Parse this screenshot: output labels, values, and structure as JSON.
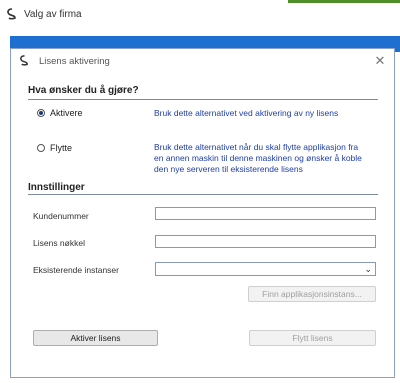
{
  "outer_window": {
    "title": "Valg av firma"
  },
  "dialog": {
    "title": "Lisens aktivering",
    "close_glyph": "✕",
    "question_heading": "Hva ønsker du å gjøre?",
    "options": [
      {
        "label": "Aktivere",
        "selected": true,
        "description": "Bruk dette alternativet ved aktivering av ny lisens"
      },
      {
        "label": "Flytte",
        "selected": false,
        "description_lines": [
          "Bruk dette alternativet når du skal flytte applikasjon fra",
          "en annen maskin til denne maskinen og ønsker å koble",
          "den nye serveren til eksisterende lisens"
        ]
      }
    ],
    "settings_heading": "Innstillinger",
    "fields": {
      "customer_number": {
        "label": "Kundenummer",
        "value": ""
      },
      "license_key": {
        "label": "Lisens nøkkel",
        "value": ""
      },
      "existing_instances": {
        "label": "Eksisterende instanser",
        "value": ""
      }
    },
    "buttons": {
      "find_instances": "Finn applikasjonsinstans...",
      "activate": "Aktiver lisens",
      "move": "Flytt lisens"
    }
  },
  "colors": {
    "accent": "#1f6fd1",
    "link_text": "#1e3ea8",
    "green_edge": "#4f8f2a"
  },
  "icons": {
    "app_icon": "app-logo-icon",
    "dialog_icon": "app-logo-icon",
    "close": "close-icon",
    "dropdown": "chevron-down-icon"
  }
}
